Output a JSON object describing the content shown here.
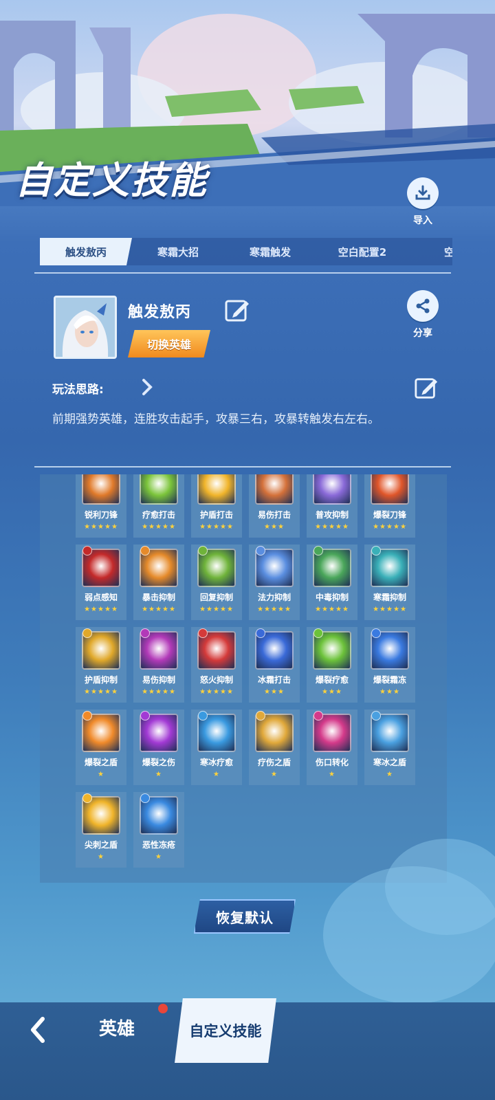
{
  "header": {
    "title": "自定义技能",
    "import_label": "导入"
  },
  "tabs": [
    {
      "label": "触发敖丙",
      "active": true
    },
    {
      "label": "寒霜大招",
      "active": false
    },
    {
      "label": "寒霜触发",
      "active": false
    },
    {
      "label": "空白配置2",
      "active": false
    },
    {
      "label": "空白",
      "active": false
    }
  ],
  "profile": {
    "name": "触发敖丙",
    "switch_label": "切换英雄",
    "share_label": "分享",
    "strategy_label": "玩法思路:",
    "strategy_text": "前期强势英雄，连胜攻击起手，攻暴三右，攻暴转触发右左右。"
  },
  "skills": [
    {
      "name": "锐利刀锋",
      "stars": "★★★★★",
      "color": "#e07a2a"
    },
    {
      "name": "疗愈打击",
      "stars": "★★★★★",
      "color": "#7bc43a"
    },
    {
      "name": "护盾打击",
      "stars": "★★★★★",
      "color": "#f0b42a"
    },
    {
      "name": "易伤打击",
      "stars": "★★★",
      "color": "#d4713a"
    },
    {
      "name": "普攻抑制",
      "stars": "★★★★★",
      "color": "#8a6ad8"
    },
    {
      "name": "爆裂刀锋",
      "stars": "★★★★★",
      "color": "#e0562a"
    },
    {
      "name": "弱点感知",
      "stars": "★★★★★",
      "color": "#c42a2a"
    },
    {
      "name": "暴击抑制",
      "stars": "★★★★★",
      "color": "#e58a2a"
    },
    {
      "name": "回复抑制",
      "stars": "★★★★★",
      "color": "#6fb33a"
    },
    {
      "name": "法力抑制",
      "stars": "★★★★★",
      "color": "#5a8ee0"
    },
    {
      "name": "中毒抑制",
      "stars": "★★★★★",
      "color": "#4aa65a"
    },
    {
      "name": "寒霜抑制",
      "stars": "★★★★★",
      "color": "#3ab0b8"
    },
    {
      "name": "护盾抑制",
      "stars": "★★★★★",
      "color": "#e0a82a"
    },
    {
      "name": "易伤抑制",
      "stars": "★★★★★",
      "color": "#b23ab8"
    },
    {
      "name": "怒火抑制",
      "stars": "★★★★★",
      "color": "#d43a3a"
    },
    {
      "name": "冰霜打击",
      "stars": "★★★",
      "color": "#3a6ad8"
    },
    {
      "name": "爆裂疗愈",
      "stars": "★★★",
      "color": "#6cc23a"
    },
    {
      "name": "爆裂霜冻",
      "stars": "★★★",
      "color": "#3a7ae0"
    },
    {
      "name": "爆裂之盾",
      "stars": "★",
      "color": "#f08a2a"
    },
    {
      "name": "爆裂之伤",
      "stars": "★",
      "color": "#a23ad4"
    },
    {
      "name": "寒冰疗愈",
      "stars": "★",
      "color": "#3a9ae0"
    },
    {
      "name": "疗伤之盾",
      "stars": "★",
      "color": "#e0a83a"
    },
    {
      "name": "伤口转化",
      "stars": "★",
      "color": "#d43a8a"
    },
    {
      "name": "寒冰之盾",
      "stars": "★",
      "color": "#4aa0e0"
    },
    {
      "name": "尖刺之盾",
      "stars": "★",
      "color": "#f0b42a"
    },
    {
      "name": "恶性冻疮",
      "stars": "★",
      "color": "#3a8ae0"
    }
  ],
  "reset_label": "恢复默认",
  "nav": {
    "back_icon": "chevron-left-icon",
    "heroes_label": "英雄",
    "custom_label": "自定义技能"
  }
}
